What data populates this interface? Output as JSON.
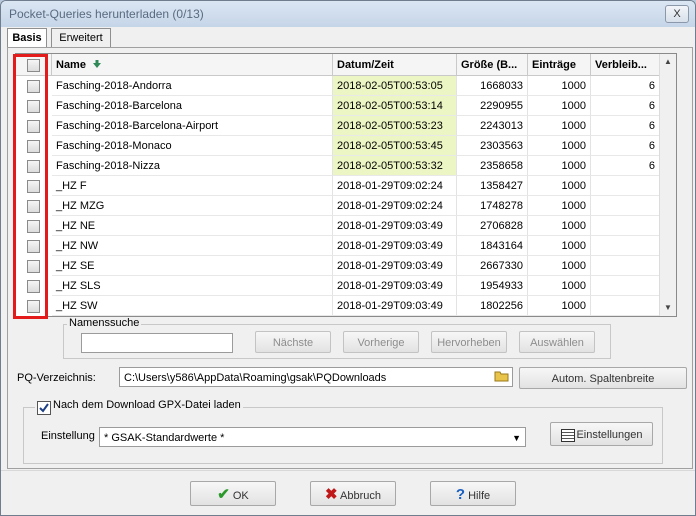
{
  "window": {
    "title": "Pocket-Queries herunterladen   (0/13)",
    "close_label": "X"
  },
  "tabs": [
    {
      "label": "Basis"
    },
    {
      "label": "Erweitert"
    }
  ],
  "table": {
    "headers": {
      "name": "Name",
      "date": "Datum/Zeit",
      "size": "Größe (B...",
      "entries": "Einträge",
      "remaining": "Verbleib..."
    },
    "rows": [
      {
        "name": "Fasching-2018-Andorra",
        "date": "2018-02-05T00:53:05",
        "size": "1668033",
        "entries": "1000",
        "remaining": "6",
        "highlight": true
      },
      {
        "name": "Fasching-2018-Barcelona",
        "date": "2018-02-05T00:53:14",
        "size": "2290955",
        "entries": "1000",
        "remaining": "6",
        "highlight": true
      },
      {
        "name": "Fasching-2018-Barcelona-Airport",
        "date": "2018-02-05T00:53:23",
        "size": "2243013",
        "entries": "1000",
        "remaining": "6",
        "highlight": true
      },
      {
        "name": "Fasching-2018-Monaco",
        "date": "2018-02-05T00:53:45",
        "size": "2303563",
        "entries": "1000",
        "remaining": "6",
        "highlight": true
      },
      {
        "name": "Fasching-2018-Nizza",
        "date": "2018-02-05T00:53:32",
        "size": "2358658",
        "entries": "1000",
        "remaining": "6",
        "highlight": true
      },
      {
        "name": "_HZ F",
        "date": "2018-01-29T09:02:24",
        "size": "1358427",
        "entries": "1000",
        "remaining": "",
        "highlight": false
      },
      {
        "name": "_HZ MZG",
        "date": "2018-01-29T09:02:24",
        "size": "1748278",
        "entries": "1000",
        "remaining": "",
        "highlight": false
      },
      {
        "name": "_HZ NE",
        "date": "2018-01-29T09:03:49",
        "size": "2706828",
        "entries": "1000",
        "remaining": "",
        "highlight": false
      },
      {
        "name": "_HZ NW",
        "date": "2018-01-29T09:03:49",
        "size": "1843164",
        "entries": "1000",
        "remaining": "",
        "highlight": false
      },
      {
        "name": "_HZ SE",
        "date": "2018-01-29T09:03:49",
        "size": "2667330",
        "entries": "1000",
        "remaining": "",
        "highlight": false
      },
      {
        "name": "_HZ SLS",
        "date": "2018-01-29T09:03:49",
        "size": "1954933",
        "entries": "1000",
        "remaining": "",
        "highlight": false
      },
      {
        "name": "_HZ SW",
        "date": "2018-01-29T09:03:49",
        "size": "1802256",
        "entries": "1000",
        "remaining": "",
        "highlight": false
      }
    ]
  },
  "name_search": {
    "legend": "Namenssuche",
    "value": "",
    "next": "Nächste",
    "prev": "Vorherige",
    "highlight": "Hervorheben",
    "select": "Auswählen"
  },
  "pq_dir": {
    "label": "PQ-Verzeichnis:",
    "value": "C:\\Users\\y586\\AppData\\Roaming\\gsak\\PQDownloads",
    "autofit": "Autom. Spaltenbreite"
  },
  "gpx": {
    "checkbox_label": "Nach dem Download GPX-Datei laden",
    "setting_label": "Einstellung",
    "setting_value": "* GSAK-Standardwerte *",
    "settings_button": "Einstellungen"
  },
  "buttons": {
    "ok": "OK",
    "cancel": "Abbruch",
    "help": "Hilfe"
  },
  "colors": {
    "highlight": "#ecf5c4",
    "selection_outline": "#e31b1b"
  }
}
